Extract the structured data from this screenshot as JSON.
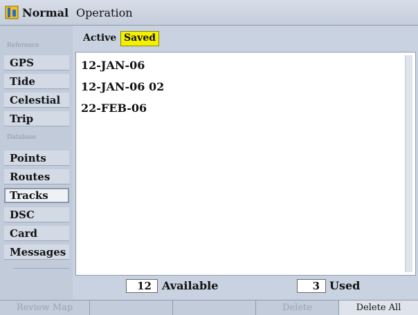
{
  "header": {
    "title_a": "Normal",
    "title_b": "Operation",
    "icon": "mode-icon"
  },
  "sidebar": {
    "sections": [
      {
        "label": "Reference"
      },
      {
        "label": "Database"
      }
    ],
    "items": [
      {
        "label": "GPS"
      },
      {
        "label": "Tide"
      },
      {
        "label": "Celestial"
      },
      {
        "label": "Trip"
      },
      {
        "label": "Points"
      },
      {
        "label": "Routes"
      },
      {
        "label": "Tracks"
      },
      {
        "label": "DSC"
      },
      {
        "label": "Card"
      },
      {
        "label": "Messages"
      }
    ],
    "selected": "Tracks"
  },
  "tabs": [
    {
      "label": "Active"
    },
    {
      "label": "Saved"
    }
  ],
  "selected_tab": "Saved",
  "tracks": {
    "items": [
      "12-JAN-06",
      "12-JAN-06 02",
      "22-FEB-06"
    ]
  },
  "counts": {
    "available": "12",
    "available_label": "Available",
    "used": "3",
    "used_label": "Used"
  },
  "softkeys": [
    {
      "label": "Review Map",
      "enabled": false
    },
    {
      "label": "",
      "enabled": false
    },
    {
      "label": "",
      "enabled": false
    },
    {
      "label": "Delete",
      "enabled": false
    },
    {
      "label": "Delete All",
      "enabled": true
    }
  ],
  "colors": {
    "highlight": "#f5f000",
    "background": "#c9d2e0"
  }
}
